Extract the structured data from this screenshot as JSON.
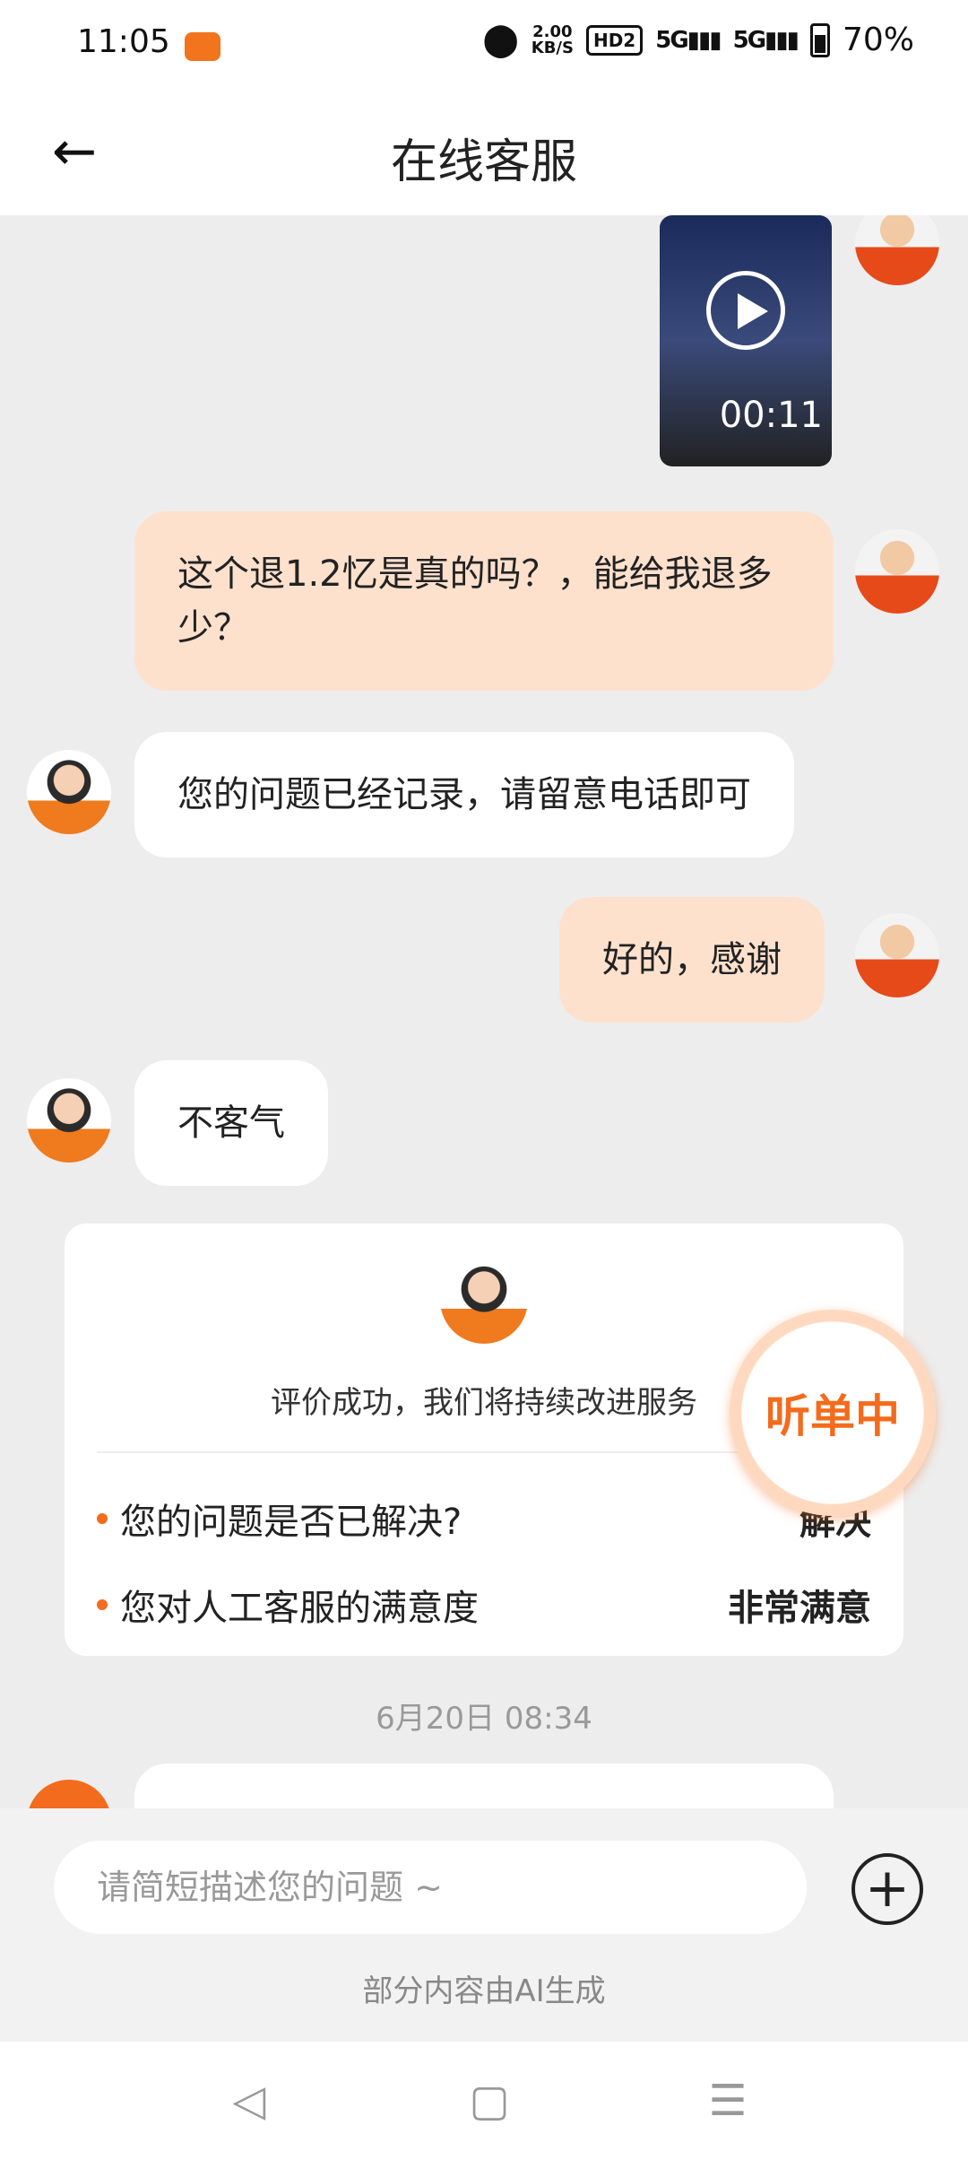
{
  "status_bar": {
    "time": "11:05",
    "speed": "2.00",
    "speed_unit": "KB/S",
    "hd_label": "HD2",
    "signal1": "5G",
    "signal2": "5G",
    "battery": "70%"
  },
  "header": {
    "title": "在线客服"
  },
  "video": {
    "duration": "00:11"
  },
  "messages": [
    {
      "from": "user",
      "text": "这个退1.2忆是真的吗？，能给我退多少？"
    },
    {
      "from": "agent",
      "text": "您的问题已经记录，请留意电话即可"
    },
    {
      "from": "user",
      "text": "好的，感谢"
    },
    {
      "from": "agent",
      "text": "不客气"
    }
  ],
  "rating_card": {
    "message": "评价成功，我们将持续改进服务",
    "rows": [
      {
        "question": "您的问题是否已解决?",
        "answer": "解决"
      },
      {
        "question": "您对人工客服的满意度",
        "answer": "非常满意"
      }
    ]
  },
  "timestamp": "6月20日 08:34",
  "floating_button": {
    "label": "听单中"
  },
  "input": {
    "placeholder": "请简短描述您的问题 ~"
  },
  "ai_note": "部分内容由AI生成",
  "colors": {
    "accent": "#f36b1c",
    "user_bubble": "#fde1cd",
    "background": "#ededed"
  }
}
